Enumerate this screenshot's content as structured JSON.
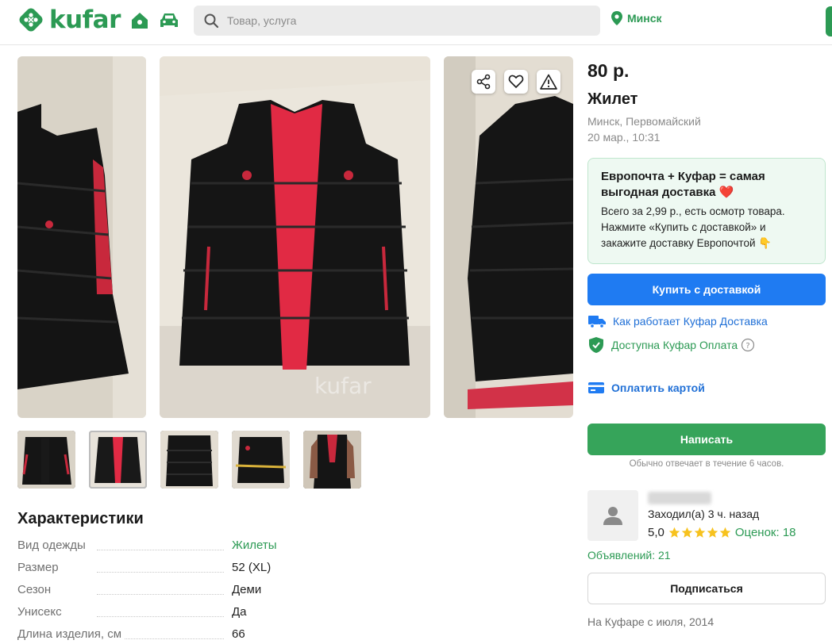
{
  "header": {
    "logo": "kufar",
    "search_placeholder": "Товар, услуга",
    "city": "Минск",
    "icons": [
      "home-icon",
      "car-icon",
      "search-icon",
      "location-pin-icon"
    ]
  },
  "listing": {
    "price": "80 р.",
    "title": "Жилет",
    "location": "Минск, Первомайский",
    "date": "20 мар., 10:31",
    "watermark": "kufar"
  },
  "promo": {
    "heading": "Европочта + Куфар = самая выгодная доставка ❤️",
    "text": "Всего за 2,99 р., есть осмотр товара. Нажмите «Купить с доставкой» и закажите доставку Европочтой 👇"
  },
  "actions": {
    "buy_delivery": "Купить с доставкой",
    "how_delivery": "Как работает Куфар Доставка",
    "payment_available": "Доступна Куфар Оплата",
    "pay_card": "Оплатить картой",
    "write": "Написать",
    "reply_note": "Обычно отвечает в течение 6 часов.",
    "subscribe": "Подписаться"
  },
  "seller": {
    "last_seen": "Заходил(а) 3 ч. назад",
    "rating": "5,0",
    "rating_stars": 5,
    "reviews": "Оценок: 18",
    "ads": "Объявлений: 21",
    "since": "На Куфаре с июля, 2014"
  },
  "specs": {
    "title": "Характеристики",
    "rows": [
      {
        "key": "Вид одежды",
        "value": "Жилеты"
      },
      {
        "key": "Размер",
        "value": "52 (XL)"
      },
      {
        "key": "Сезон",
        "value": "Деми"
      },
      {
        "key": "Унисекс",
        "value": "Да"
      },
      {
        "key": "Длина изделия, см",
        "value": "66"
      }
    ]
  },
  "gallery": {
    "thumbnail_count": 5,
    "active_thumbnail": 2
  },
  "colors": {
    "brand_green": "#2c9a54",
    "button_blue": "#1f7bf2",
    "button_green": "#36a45a",
    "link_blue": "#1f6fd6",
    "star": "#f7c21e"
  }
}
